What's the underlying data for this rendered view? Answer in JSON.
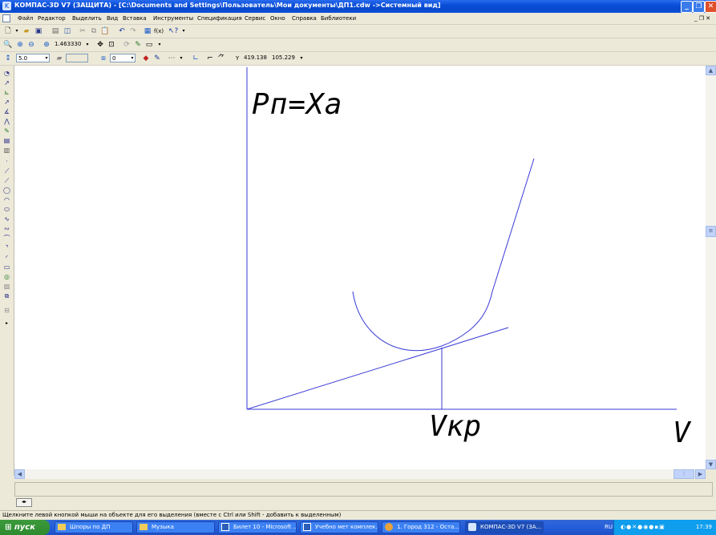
{
  "window": {
    "title": "КОМПАС-3D V7 (ЗАЩИТА) - [C:\\Documents and Settings\\Пользователь\\Мои документы\\ДП1.cdw ->Системный вид]",
    "controls": [
      "_",
      "❐",
      "✕"
    ]
  },
  "menu": {
    "items": [
      "Файл",
      "Редактор",
      "Выделить",
      "Вид",
      "Вставка",
      "Инструменты",
      "Спецификация",
      "Сервис",
      "Окно",
      "Справка",
      "Библиотеки"
    ],
    "doc_controls": "_ ❐ ✕"
  },
  "toolbar2": {
    "zoom_value": "1.463330"
  },
  "toolbar3": {
    "step_value": "5.0",
    "layer_value": "0",
    "coord_label": "Y",
    "coord_x": "419.138",
    "coord_y": "105.229"
  },
  "drawing": {
    "label_y": "Pп=Xa",
    "label_vkp": "Vкр",
    "label_v": "V",
    "line_color": "#3a3ad6"
  },
  "statusbar": {
    "text": "Щелкните левой кнопкой мыши на объекте для его выделения (вместе с Ctrl или Shift - добавить к выделенным)"
  },
  "taskbar": {
    "start_label": "пуск",
    "tasks": [
      {
        "label": "Шпоры по ДП",
        "icon": "folder-icon"
      },
      {
        "label": "Музыка",
        "icon": "folder-icon"
      },
      {
        "label": "Билет 10 - Microsoft ...",
        "icon": "word-icon"
      },
      {
        "label": "Учебно мет комплек...",
        "icon": "word-icon"
      },
      {
        "label": "1. Город 312 - Оста...",
        "icon": "player-icon"
      },
      {
        "label": "КОМПАС-3D V7 (ЗА...",
        "icon": "kompas-icon"
      }
    ],
    "language": "RU",
    "clock": "17:39"
  }
}
